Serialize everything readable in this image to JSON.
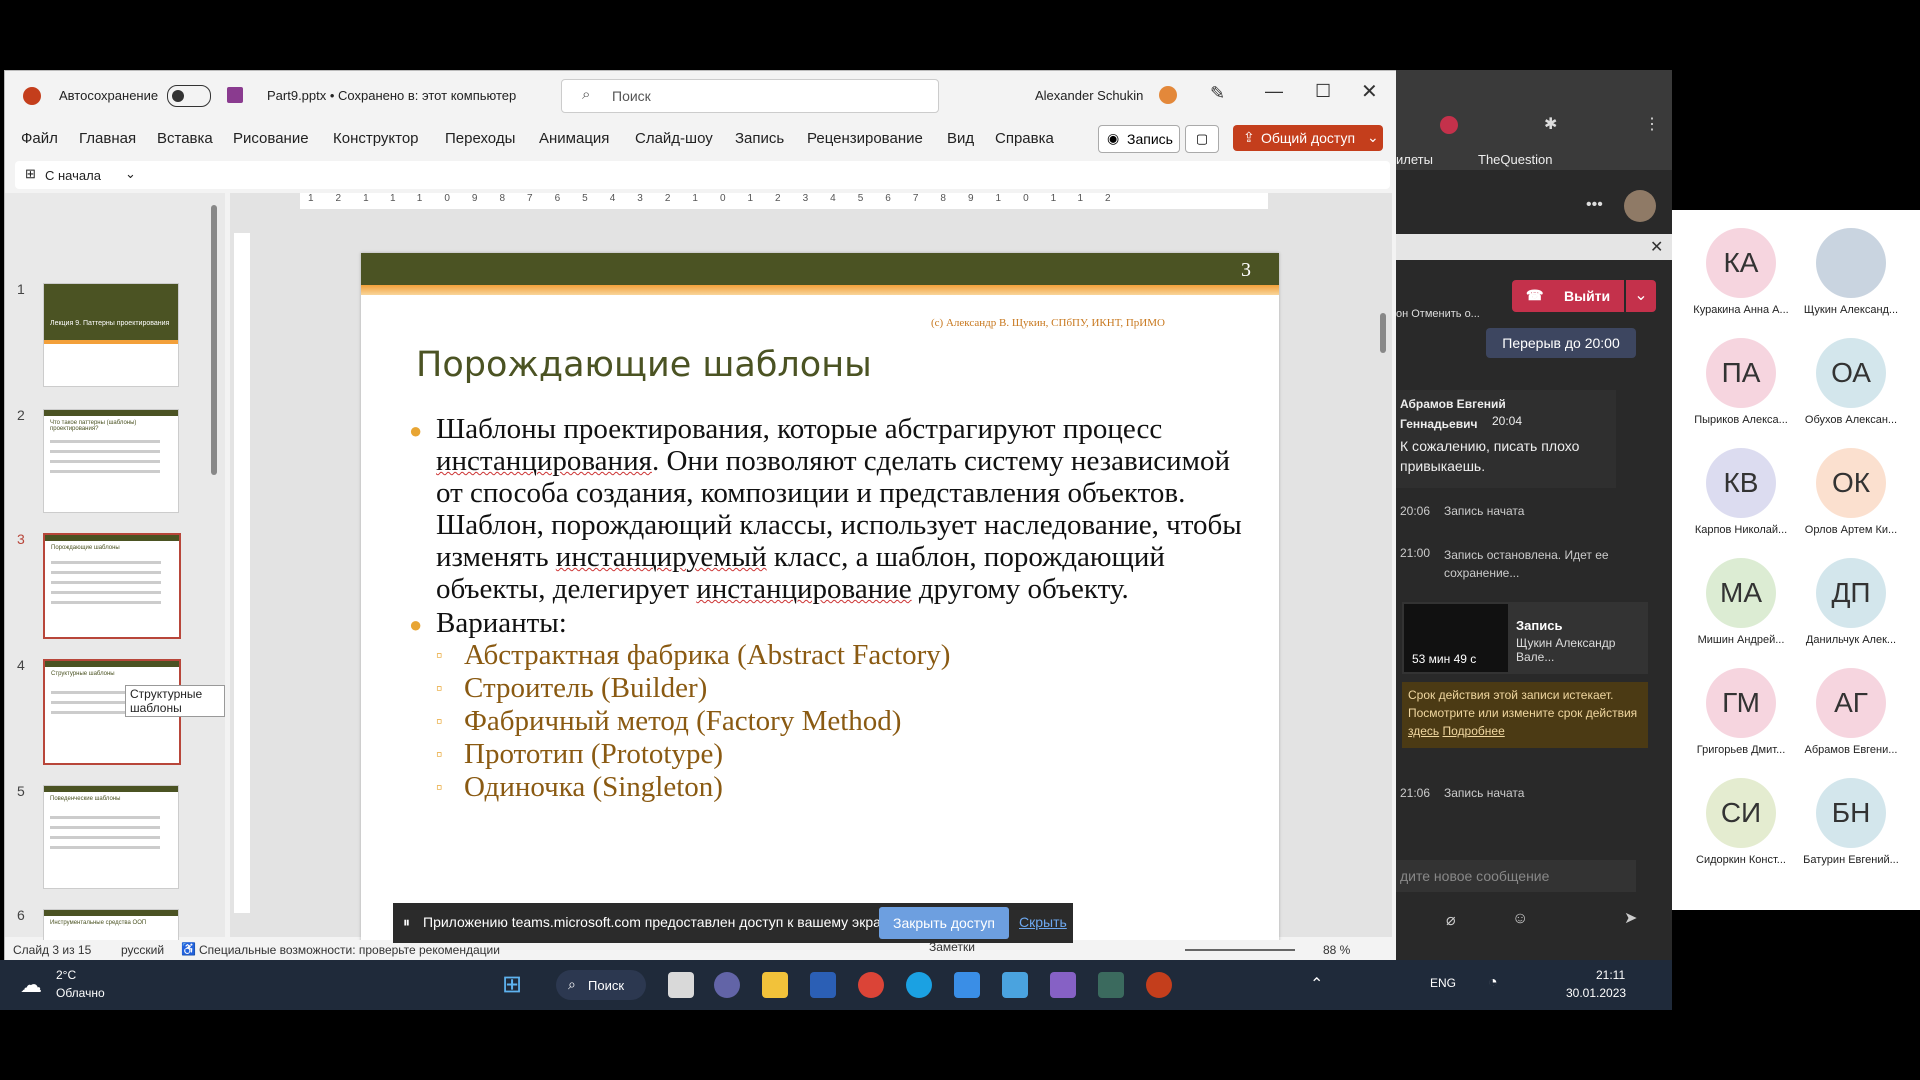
{
  "pp": {
    "autosave_label": "Автосохранение",
    "doc_title": "Part9.pptx • Сохранено в: этот компьютер",
    "search_placeholder": "Поиск",
    "user_name": "Alexander Schukin",
    "menu": [
      "Файл",
      "Главная",
      "Вставка",
      "Рисование",
      "Конструктор",
      "Переходы",
      "Анимация",
      "Слайд-шоу",
      "Запись",
      "Рецензирование",
      "Вид",
      "Справка"
    ],
    "record_button": "Запись",
    "share_button": "Общий доступ",
    "from_start": "С начала",
    "thumb_numbers": [
      "1",
      "2",
      "3",
      "4",
      "5",
      "6"
    ],
    "thumb_titles": [
      "Лекция 9. Паттерны проектирования",
      "Что такое паттерны (шаблоны) проектирования?",
      "Порождающие шаблоны",
      "Структурные шаблоны",
      "Поведенческие шаблоны",
      "Инструментальные средства ООП"
    ],
    "tooltip": "Структурные шаблоны",
    "slide": {
      "number": "3",
      "copyright": "(c) Александр В. Щукин, СПбПУ, ИКНТ, ПрИМО",
      "title": "Порождающие шаблоны",
      "p1_a": "Шаблоны проектирования, которые абстрагируют процесс ",
      "p1_u1": "инстанцирования",
      "p1_b": ". Они позволяют сделать систему независимой от способа создания, композиции и представления объектов. Шаблон, порождающий классы, использует наследование, чтобы изменять ",
      "p1_u2": "инстанцируемый",
      "p1_c": " класс, а шаблон, порождающий объекты, делегирует ",
      "p1_u3": "инстанцирование",
      "p1_d": " другому объекту.",
      "variants": "Варианты:",
      "items": [
        "Абстрактная фабрика (Abstract Factory)",
        "Строитель (Builder)",
        "Фабричный метод (Factory Method)",
        "Прототип (Prototype)",
        "Одиночка (Singleton)"
      ]
    },
    "status": {
      "slide_of": "Слайд 3 из 15",
      "lang": "русский",
      "accessibility": "Специальные возможности: проверьте рекомендации",
      "notes": "Заметки",
      "zoom": "88 %"
    }
  },
  "notification": {
    "text": "Приложению teams.microsoft.com предоставлен доступ к вашему экрану.",
    "stop": "Закрыть доступ",
    "hide": "Скрыть"
  },
  "teams": {
    "bookmark1": "илеты",
    "bookmark2": "TheQuestion",
    "cancel_label": "он  Отменить о...",
    "leave": "Выйти",
    "break": "Перерыв до 20:00",
    "msg_author": "Абрамов Евгений Геннадьевич",
    "msg_time": "20:04",
    "msg_text": "К сожалению, писать плохо привыкаешь.",
    "ev1_time": "20:06",
    "ev1": "Запись начата",
    "ev2_time": "21:00",
    "ev2": "Запись остановлена. Идет ее сохранение...",
    "rec_title": "Запись",
    "rec_author": "Щукин Александр Вале...",
    "rec_duration": "53 мин 49 с",
    "warn_text": "Срок действия этой записи истекает. Посмотрите или измените срок действия",
    "warn_link1": "здесь",
    "warn_link2": "Подробнее",
    "ev3_time": "21:06",
    "ev3": "Запись начата",
    "compose_placeholder": "дите новое сообщение"
  },
  "participants": [
    {
      "initials": "КА",
      "name": "Куракина Анна А...",
      "color": "#f6d5df"
    },
    {
      "initials": "",
      "name": "Щукин Александ...",
      "color": "#c9d4e0"
    },
    {
      "initials": "ПА",
      "name": "Пыриков Алекса...",
      "color": "#f6d5df"
    },
    {
      "initials": "ОА",
      "name": "Обухов Алексан...",
      "color": "#d3e6ec"
    },
    {
      "initials": "КВ",
      "name": "Карпов Николай...",
      "color": "#dcdcf0"
    },
    {
      "initials": "ОК",
      "name": "Орлов Артем Ки...",
      "color": "#fbe0cf"
    },
    {
      "initials": "МА",
      "name": "Мишин Андрей...",
      "color": "#dcecd3"
    },
    {
      "initials": "ДП",
      "name": "Данильчук Алек...",
      "color": "#d3e6ec"
    },
    {
      "initials": "ГМ",
      "name": "Григорьев Дмит...",
      "color": "#f6d5df"
    },
    {
      "initials": "АГ",
      "name": "Абрамов Евгени...",
      "color": "#f6d5df"
    },
    {
      "initials": "СИ",
      "name": "Сидоркин Конст...",
      "color": "#e4ecd0"
    },
    {
      "initials": "БН",
      "name": "Батурин Евгений...",
      "color": "#d3e6ec"
    }
  ],
  "taskbar": {
    "temp": "2°C",
    "weather": "Облачно",
    "search": "Поиск",
    "lang": "ENG",
    "time": "21:11",
    "date": "30.01.2023"
  },
  "colors": {
    "accent": "#c43e1c",
    "olive": "#4b5323",
    "orange": "#e8a533",
    "teams_red": "#c4314b"
  }
}
